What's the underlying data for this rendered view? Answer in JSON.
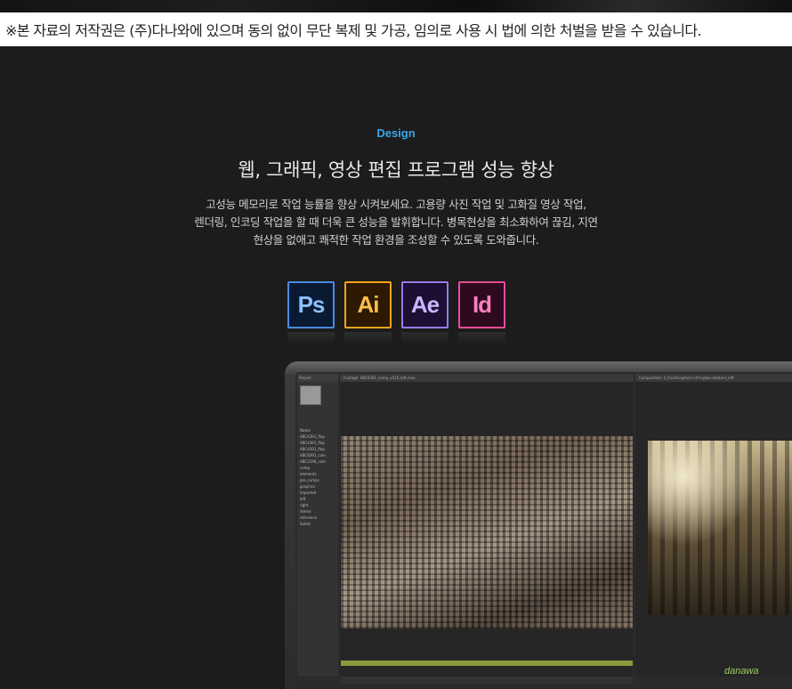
{
  "notice": "※본 자료의 저작권은 (주)다나와에 있으며 동의 없이 무단 복제 및 가공, 임의로 사용 시 법에 의한 처벌을 받을 수 있습니다.",
  "section": {
    "label": "Design",
    "title": "웹, 그래픽, 영상 편집 프로그램 성능 향상",
    "description_lines": [
      "고성능 메모리로 작업 능률을 향상 시켜보세요. 고용량 사진 작업 및 고화질 영상 작업,",
      "렌더링, 인코딩 작업을 할 때 더욱 큰 성능을 발휘합니다. 병목현상을 최소화하여 끊김, 지연",
      "현상을 없애고 쾌적한 작업 환경을 조성할 수 있도록 도와줍니다."
    ]
  },
  "apps": [
    {
      "abbr": "Ps",
      "color": "#4d8ae0"
    },
    {
      "abbr": "Ai",
      "color": "#f2a51c"
    },
    {
      "abbr": "Ae",
      "color": "#9b7ae6"
    },
    {
      "abbr": "Id",
      "color": "#e84d99"
    }
  ],
  "editor": {
    "project_tab": "Project",
    "footage_tab": "Footage: ABC8391_comp_v018_left.mov",
    "composition_tab": "Composition: 2_frontGraphics+30+glow+texture_left",
    "project_items": [
      "Name",
      "ABC4391_flop",
      "ABC4391_flop",
      "ABC4391_flop",
      "ABC8391_com",
      "ABC2196_com",
      "comp",
      "elements",
      "pre_comps",
      "graphics",
      "imported",
      "left",
      "right",
      "stereo",
      "reference",
      "Solids"
    ]
  },
  "watermark": "danawa"
}
